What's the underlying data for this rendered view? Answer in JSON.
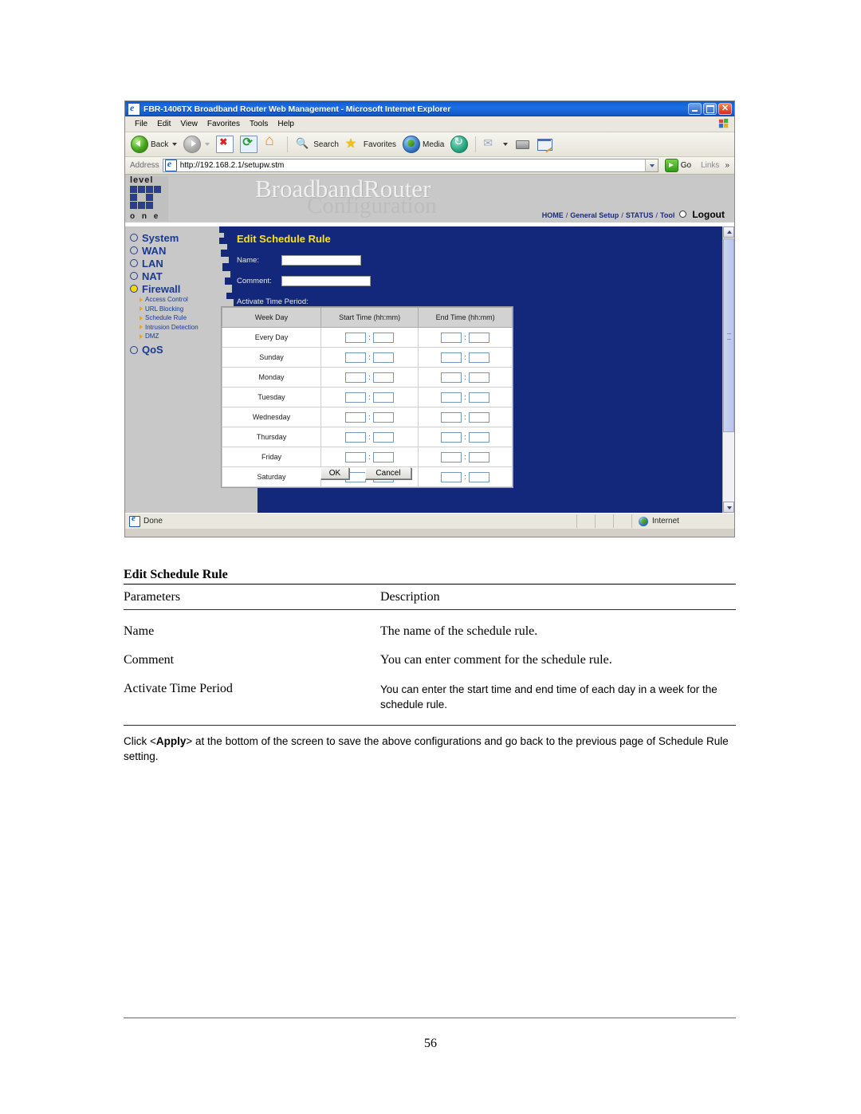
{
  "browser": {
    "title": "FBR-1406TX Broadband Router Web Management - Microsoft Internet Explorer",
    "window_controls": {
      "minimize": "_",
      "maximize": "❐",
      "close": "✕"
    },
    "menu": [
      "File",
      "Edit",
      "View",
      "Favorites",
      "Tools",
      "Help"
    ],
    "toolbar": {
      "back": "Back",
      "forward": "",
      "stop": "",
      "refresh": "",
      "home": "",
      "search": "Search",
      "favorites": "Favorites",
      "media": "Media",
      "history": "",
      "mail": "",
      "print": "",
      "edit": ""
    },
    "address": {
      "label": "Address",
      "value": "http://192.168.2.1/setupw.stm",
      "go_label": "Go",
      "links_label": "Links",
      "chevrons": "»"
    },
    "status": {
      "text": "Done",
      "zone": "Internet"
    }
  },
  "router": {
    "brand": {
      "word_top": "level",
      "sup": "®",
      "word_bottom": "o n e"
    },
    "header": {
      "title": "BroadbandRouter",
      "subtitle": "Configuration",
      "nav": [
        "HOME",
        "General Setup",
        "STATUS",
        "Tool"
      ],
      "separator": "/",
      "logout": "Logout"
    },
    "sidebar": {
      "items": [
        {
          "label": "System",
          "selected": false
        },
        {
          "label": "WAN",
          "selected": false
        },
        {
          "label": "LAN",
          "selected": false
        },
        {
          "label": "NAT",
          "selected": false
        },
        {
          "label": "Firewall",
          "selected": true
        }
      ],
      "subitems": [
        "Access Control",
        "URL Blocking",
        "Schedule Rule",
        "Intrusion Detection",
        "DMZ"
      ],
      "last_item": {
        "label": "QoS",
        "selected": false
      }
    },
    "page": {
      "title": "Edit Schedule Rule",
      "name_label": "Name:",
      "name_value": "",
      "comment_label": "Comment:",
      "comment_value": "",
      "activate_label": "Activate Time Period:",
      "table": {
        "headers": [
          "Week Day",
          "Start Time (hh:mm)",
          "End Time (hh:mm)"
        ],
        "rows": [
          {
            "day": "Every Day",
            "start_hh": "",
            "start_mm": "",
            "end_hh": "",
            "end_mm": ""
          },
          {
            "day": "Sunday",
            "start_hh": "",
            "start_mm": "",
            "end_hh": "",
            "end_mm": ""
          },
          {
            "day": "Monday",
            "start_hh": "",
            "start_mm": "",
            "end_hh": "",
            "end_mm": ""
          },
          {
            "day": "Tuesday",
            "start_hh": "",
            "start_mm": "",
            "end_hh": "",
            "end_mm": ""
          },
          {
            "day": "Wednesday",
            "start_hh": "",
            "start_mm": "",
            "end_hh": "",
            "end_mm": ""
          },
          {
            "day": "Thursday",
            "start_hh": "",
            "start_mm": "",
            "end_hh": "",
            "end_mm": ""
          },
          {
            "day": "Friday",
            "start_hh": "",
            "start_mm": "",
            "end_hh": "",
            "end_mm": ""
          },
          {
            "day": "Saturday",
            "start_hh": "",
            "start_mm": "",
            "end_hh": "",
            "end_mm": ""
          }
        ],
        "colon": ":"
      },
      "ok_button": "OK",
      "cancel_button": "Cancel"
    }
  },
  "doc": {
    "heading": "Edit Schedule Rule",
    "col_headers": {
      "parameters": "Parameters",
      "description": "Description"
    },
    "rows": [
      {
        "parameter": "Name",
        "description": "The name of the schedule rule."
      },
      {
        "parameter": "Comment",
        "description": "You can enter comment for the schedule rule."
      },
      {
        "parameter": "Activate Time Period",
        "description": "You can enter the start time and end time of each day in a week for the schedule rule."
      }
    ],
    "note_prefix": "Click <",
    "note_bold": "Apply",
    "note_suffix": "> at the bottom of the screen to save the above configurations and go back to the previous page of Schedule Rule setting.",
    "page_number": "56"
  },
  "colors": {
    "router_blue": "#13287a",
    "title_yellow": "#ffe600",
    "menu_blue": "#1b3a8f",
    "sidebar_gray": "#c8c8c8"
  }
}
